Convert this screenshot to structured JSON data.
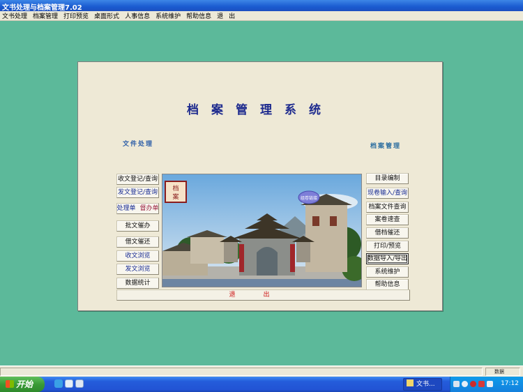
{
  "window": {
    "title": "文书处理与档案管理7.02"
  },
  "menu": [
    "文书处理",
    "档案管理",
    "打印预览",
    "桌面形式",
    "人事信息",
    "系统维护",
    "帮助信息",
    "退",
    "出"
  ],
  "app": {
    "title": "档案管理系统"
  },
  "left_section": {
    "title": "文件处理",
    "buttons": [
      "收文登记/查询",
      "发文登记/查询",
      "批文催办",
      "借文催还",
      "收文浏览",
      "发文浏览",
      "数据统计"
    ],
    "split": {
      "a": "处理单",
      "b": "督办单"
    }
  },
  "right_section": {
    "title": "档案管理",
    "buttons": [
      "目录编制",
      "现卷输入/查询",
      "档案文件查询",
      "案卷速查",
      "借档催还",
      "打印/预览",
      "数据导入/导出",
      "系统维护",
      "帮助信息"
    ]
  },
  "exit_label": "退出",
  "photo": {
    "seal_text": "档案管理",
    "badge_text": "组卷链接"
  },
  "statusbar": {
    "indicator": "数据"
  },
  "taskbar": {
    "start_label": "开始",
    "task_label": "文书...",
    "clock": "17:12"
  },
  "colors": {
    "desktop": "#5cb99a",
    "panel": "#eee9d6",
    "title": "#1d2a8e",
    "exit": "#cc1111"
  }
}
